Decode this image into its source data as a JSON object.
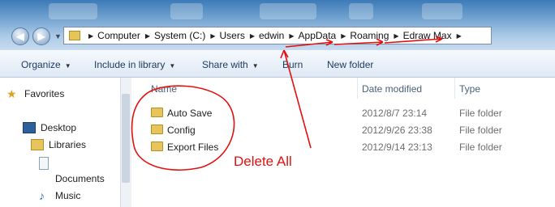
{
  "address": {
    "crumbs": [
      "Computer",
      "System (C:)",
      "Users",
      "edwin",
      "AppData",
      "Roaming",
      "Edraw Max"
    ]
  },
  "toolbar": {
    "organize": "Organize",
    "include": "Include in library",
    "share": "Share with",
    "burn": "Burn",
    "new_folder": "New folder"
  },
  "nav": {
    "favorites": "Favorites",
    "desktop": "Desktop",
    "libraries": "Libraries",
    "documents": "Documents",
    "music": "Music"
  },
  "columns": {
    "name": "Name",
    "date": "Date modified",
    "type": "Type"
  },
  "files": [
    {
      "name": "Auto Save",
      "date": "2012/8/7 23:14",
      "type": "File folder"
    },
    {
      "name": "Config",
      "date": "2012/9/26 23:38",
      "type": "File folder"
    },
    {
      "name": "Export Files",
      "date": "2012/9/14 23:13",
      "type": "File folder"
    }
  ],
  "annotation": {
    "text": "Delete All",
    "color": "#e31010"
  }
}
